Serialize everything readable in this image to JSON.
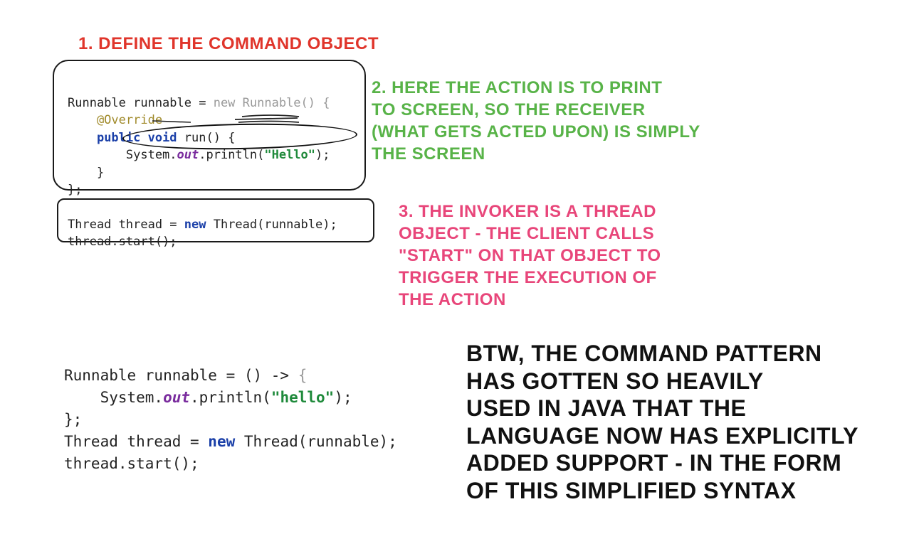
{
  "step1": {
    "text": "1. DEFINE THE COMMAND OBJECT"
  },
  "step2": {
    "lines": [
      "2. HERE THE ACTION IS TO PRINT",
      "TO SCREEN, SO THE RECEIVER",
      "(WHAT GETS ACTED UPON) IS SIMPLY",
      "THE SCREEN"
    ]
  },
  "step3": {
    "lines": [
      "3. THE INVOKER IS A THREAD",
      "OBJECT - THE CLIENT CALLS",
      "\"START\" ON THAT OBJECT TO",
      "TRIGGER THE EXECUTION OF",
      "THE ACTION"
    ]
  },
  "code1": {
    "l1a": "Runnable runnable = ",
    "l1b": "new",
    "l1c": " Runnable() {",
    "l2": "    @Override",
    "l3a": "    ",
    "l3b": "public void",
    "l3c": " run() {",
    "l4a": "        System.",
    "l4b": "out",
    "l4c": ".println(",
    "l4d": "\"Hello\"",
    "l4e": ");",
    "l5": "    }",
    "l6": "};"
  },
  "code2": {
    "l1a": "Thread thread = ",
    "l1b": "new",
    "l1c": " Thread(runnable);",
    "l2": "thread.start();"
  },
  "code3": {
    "l1a": "Runnable runnable = () -> ",
    "l1b": "{",
    "l2a": "    System.",
    "l2b": "out",
    "l2c": ".println(",
    "l2d": "\"hello\"",
    "l2e": ");",
    "l3": "};",
    "l4": "",
    "l5a": "Thread thread = ",
    "l5b": "new",
    "l5c": " Thread(runnable);",
    "l6": "thread.start();"
  },
  "btw": {
    "lines": [
      "BTW, THE COMMAND PATTERN",
      "HAS GOTTEN SO HEAVILY",
      "USED IN JAVA THAT THE",
      "LANGUAGE NOW HAS EXPLICITLY",
      "ADDED SUPPORT - IN THE FORM",
      "OF THIS SIMPLIFIED SYNTAX"
    ]
  }
}
